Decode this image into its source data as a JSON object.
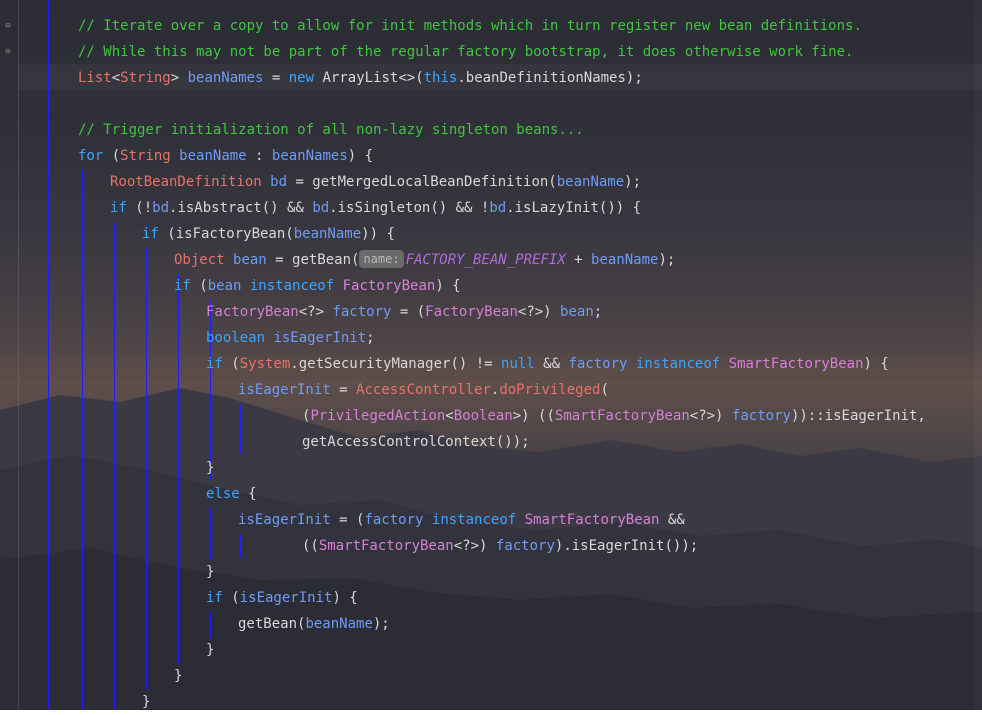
{
  "editor": {
    "colors": {
      "comment": "#42c442",
      "keyword": "#3aa6ff",
      "type": "#e8726a",
      "class": "#d87fd8",
      "variable": "#6e9cf5",
      "plain": "#d8d8d8",
      "static_field": "#b06bdc",
      "indent_guide": "#1f20ff"
    },
    "gutter": {
      "fold_icons": [
        "fold-end-icon",
        "fold-end-icon"
      ]
    },
    "lines": [
      {
        "tokens": [
          [
            "cm",
            "// Iterate over a copy to allow for init methods which in turn register new bean definitions."
          ]
        ]
      },
      {
        "tokens": [
          [
            "cm",
            "// While this may not be part of the regular factory bootstrap, it does otherwise work fine."
          ]
        ]
      },
      {
        "tokens": [
          [
            "ty",
            "List"
          ],
          [
            "pl",
            "<"
          ],
          [
            "ty",
            "String"
          ],
          [
            "pl",
            "> "
          ],
          [
            "va",
            "beanNames"
          ],
          [
            "pl",
            " = "
          ],
          [
            "kw",
            "new"
          ],
          [
            "pl",
            " ArrayList<>("
          ],
          [
            "kw",
            "this"
          ],
          [
            "pl",
            ".beanDefinitionNames);"
          ]
        ]
      },
      {
        "tokens": []
      },
      {
        "tokens": [
          [
            "cm",
            "// Trigger initialization of all non-lazy singleton beans..."
          ]
        ]
      },
      {
        "tokens": [
          [
            "kw",
            "for"
          ],
          [
            "pl",
            " ("
          ],
          [
            "ty",
            "String"
          ],
          [
            "pl",
            " "
          ],
          [
            "va",
            "beanName"
          ],
          [
            "pl",
            " : "
          ],
          [
            "va",
            "beanNames"
          ],
          [
            "pl",
            ") {"
          ]
        ]
      },
      {
        "tokens": [
          [
            "ty",
            "RootBeanDefinition"
          ],
          [
            "pl",
            " "
          ],
          [
            "va",
            "bd"
          ],
          [
            "pl",
            " = getMergedLocalBeanDefinition("
          ],
          [
            "va",
            "beanName"
          ],
          [
            "pl",
            ");"
          ]
        ]
      },
      {
        "tokens": [
          [
            "kw",
            "if"
          ],
          [
            "pl",
            " (!"
          ],
          [
            "va",
            "bd"
          ],
          [
            "pl",
            ".isAbstract() && "
          ],
          [
            "va",
            "bd"
          ],
          [
            "pl",
            ".isSingleton() && !"
          ],
          [
            "va",
            "bd"
          ],
          [
            "pl",
            ".isLazyInit()) {"
          ]
        ]
      },
      {
        "tokens": [
          [
            "kw",
            "if"
          ],
          [
            "pl",
            " (isFactoryBean("
          ],
          [
            "va",
            "beanName"
          ],
          [
            "pl",
            ")) {"
          ]
        ]
      },
      {
        "tokens": [
          [
            "ty",
            "Object"
          ],
          [
            "pl",
            " "
          ],
          [
            "va",
            "bean"
          ],
          [
            "pl",
            " = getBean("
          ],
          [
            "hint",
            "name:"
          ],
          [
            "st",
            "FACTORY_BEAN_PREFIX"
          ],
          [
            "pl",
            " + "
          ],
          [
            "va",
            "beanName"
          ],
          [
            "pl",
            ");"
          ]
        ]
      },
      {
        "tokens": [
          [
            "kw",
            "if"
          ],
          [
            "pl",
            " ("
          ],
          [
            "va",
            "bean"
          ],
          [
            "pl",
            " "
          ],
          [
            "kw",
            "instanceof"
          ],
          [
            "pl",
            " "
          ],
          [
            "ci",
            "FactoryBean"
          ],
          [
            "pl",
            ") {"
          ]
        ]
      },
      {
        "tokens": [
          [
            "ci",
            "FactoryBean"
          ],
          [
            "pl",
            "<?> "
          ],
          [
            "va",
            "factory"
          ],
          [
            "pl",
            " = ("
          ],
          [
            "ci",
            "FactoryBean"
          ],
          [
            "pl",
            "<?>) "
          ],
          [
            "va",
            "bean"
          ],
          [
            "pl",
            ";"
          ]
        ]
      },
      {
        "tokens": [
          [
            "kw",
            "boolean"
          ],
          [
            "pl",
            " "
          ],
          [
            "va",
            "isEagerInit"
          ],
          [
            "pl",
            ";"
          ]
        ]
      },
      {
        "tokens": [
          [
            "kw",
            "if"
          ],
          [
            "pl",
            " ("
          ],
          [
            "ty",
            "System"
          ],
          [
            "pl",
            ".getSecurityManager() != "
          ],
          [
            "kw",
            "null"
          ],
          [
            "pl",
            " && "
          ],
          [
            "va",
            "factory"
          ],
          [
            "pl",
            " "
          ],
          [
            "kw",
            "instanceof"
          ],
          [
            "pl",
            " "
          ],
          [
            "ci",
            "SmartFactoryBean"
          ],
          [
            "pl",
            ") {"
          ]
        ]
      },
      {
        "tokens": [
          [
            "va",
            "isEagerInit"
          ],
          [
            "pl",
            " = "
          ],
          [
            "ty",
            "AccessController"
          ],
          [
            "pl",
            "."
          ],
          [
            "ty",
            "doPrivileged"
          ],
          [
            "pl",
            "("
          ]
        ]
      },
      {
        "tokens": [
          [
            "pl",
            "("
          ],
          [
            "ci",
            "PrivilegedAction"
          ],
          [
            "pl",
            "<"
          ],
          [
            "ci",
            "Boolean"
          ],
          [
            "pl",
            ">) (("
          ],
          [
            "ci",
            "SmartFactoryBean"
          ],
          [
            "pl",
            "<?>) "
          ],
          [
            "va",
            "factory"
          ],
          [
            "pl",
            "))::isEagerInit,"
          ]
        ]
      },
      {
        "tokens": [
          [
            "pl",
            "getAccessControlContext());"
          ]
        ]
      },
      {
        "tokens": [
          [
            "pl",
            "}"
          ]
        ]
      },
      {
        "tokens": [
          [
            "kw",
            "else"
          ],
          [
            "pl",
            " {"
          ]
        ]
      },
      {
        "tokens": [
          [
            "va",
            "isEagerInit"
          ],
          [
            "pl",
            " = ("
          ],
          [
            "va",
            "factory"
          ],
          [
            "pl",
            " "
          ],
          [
            "kw",
            "instanceof"
          ],
          [
            "pl",
            " "
          ],
          [
            "ci",
            "SmartFactoryBean"
          ],
          [
            "pl",
            " &&"
          ]
        ]
      },
      {
        "tokens": [
          [
            "pl",
            "(("
          ],
          [
            "ci",
            "SmartFactoryBean"
          ],
          [
            "pl",
            "<?>) "
          ],
          [
            "va",
            "factory"
          ],
          [
            "pl",
            ").isEagerInit());"
          ]
        ]
      },
      {
        "tokens": [
          [
            "pl",
            "}"
          ]
        ]
      },
      {
        "tokens": [
          [
            "kw",
            "if"
          ],
          [
            "pl",
            " ("
          ],
          [
            "va",
            "isEagerInit"
          ],
          [
            "pl",
            ") {"
          ]
        ]
      },
      {
        "tokens": [
          [
            "pl",
            "getBean("
          ],
          [
            "va",
            "beanName"
          ],
          [
            "pl",
            ");"
          ]
        ]
      },
      {
        "tokens": [
          [
            "pl",
            "}"
          ]
        ]
      },
      {
        "tokens": [
          [
            "pl",
            "}"
          ]
        ]
      },
      {
        "tokens": [
          [
            "pl",
            "}"
          ]
        ]
      }
    ]
  }
}
